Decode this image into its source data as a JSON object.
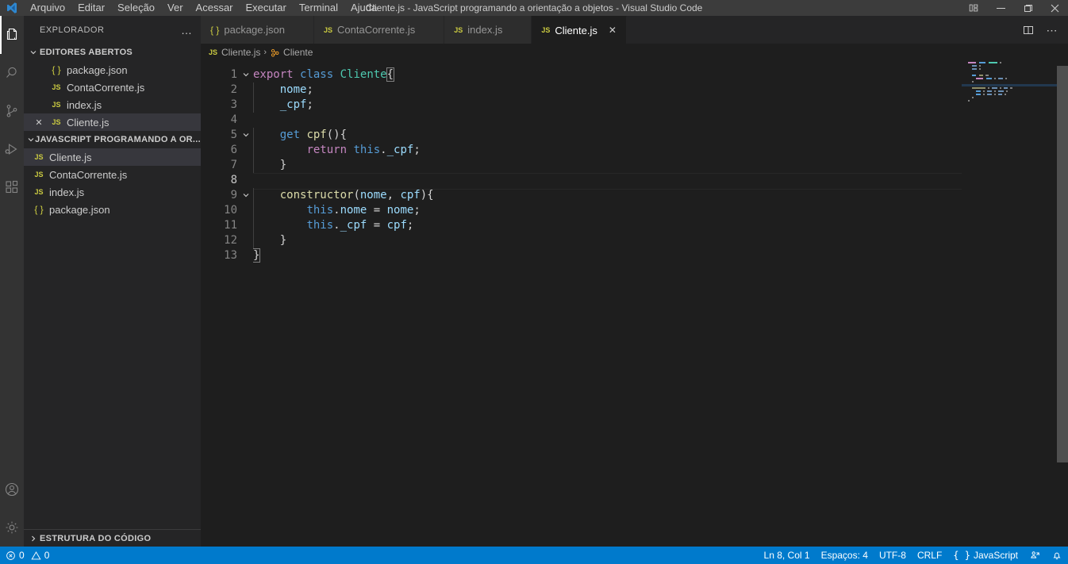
{
  "titlebar": {
    "logo_icon": "vscode-logo-icon",
    "title": "Cliente.js - JavaScript programando a orientação a objetos - Visual Studio Code",
    "menu": [
      {
        "label": "Arquivo"
      },
      {
        "label": "Editar"
      },
      {
        "label": "Seleção"
      },
      {
        "label": "Ver"
      },
      {
        "label": "Acessar"
      },
      {
        "label": "Executar"
      },
      {
        "label": "Terminal"
      },
      {
        "label": "Ajuda"
      }
    ],
    "window_controls": [
      {
        "name": "customize-layout-icon"
      },
      {
        "name": "minimize-icon"
      },
      {
        "name": "maximize-icon"
      },
      {
        "name": "close-icon"
      }
    ]
  },
  "activitybar": {
    "items": [
      {
        "name": "explorer-icon",
        "label": "Explorador",
        "active": true
      },
      {
        "name": "search-icon",
        "label": "Pesquisar",
        "active": false
      },
      {
        "name": "source-control-icon",
        "label": "Controle do Código-Fonte",
        "active": false
      },
      {
        "name": "run-debug-icon",
        "label": "Executar e Depurar",
        "active": false
      },
      {
        "name": "extensions-icon",
        "label": "Extensões",
        "active": false
      }
    ],
    "bottom": [
      {
        "name": "account-icon",
        "label": "Contas"
      },
      {
        "name": "settings-gear-icon",
        "label": "Gerenciar"
      }
    ]
  },
  "sidebar": {
    "title": "EXPLORADOR",
    "more_actions": "…",
    "open_editors": {
      "header": "EDITORES ABERTOS",
      "expanded": true,
      "items": [
        {
          "name": "package.json",
          "icon": "json-file-icon",
          "selected": false,
          "has_close": false
        },
        {
          "name": "ContaCorrente.js",
          "icon": "js-file-icon",
          "selected": false,
          "has_close": false
        },
        {
          "name": "index.js",
          "icon": "js-file-icon",
          "selected": false,
          "has_close": false
        },
        {
          "name": "Cliente.js",
          "icon": "js-file-icon",
          "selected": true,
          "has_close": true
        }
      ]
    },
    "project": {
      "header": "JAVASCRIPT PROGRAMANDO A OR...",
      "expanded": true,
      "items": [
        {
          "name": "Cliente.js",
          "icon": "js-file-icon",
          "selected": true
        },
        {
          "name": "ContaCorrente.js",
          "icon": "js-file-icon",
          "selected": false
        },
        {
          "name": "index.js",
          "icon": "js-file-icon",
          "selected": false
        },
        {
          "name": "package.json",
          "icon": "json-file-icon",
          "selected": false
        }
      ]
    },
    "outline": {
      "header": "ESTRUTURA DO CÓDIGO",
      "expanded": false
    }
  },
  "editor": {
    "tabs": [
      {
        "label": "package.json",
        "icon": "json-file-icon",
        "active": false
      },
      {
        "label": "ContaCorrente.js",
        "icon": "js-file-icon",
        "active": false
      },
      {
        "label": "index.js",
        "icon": "js-file-icon",
        "active": false
      },
      {
        "label": "Cliente.js",
        "icon": "js-file-icon",
        "active": true,
        "close": "✕"
      }
    ],
    "actions": [
      {
        "name": "split-editor-icon"
      },
      {
        "name": "more-actions-icon",
        "label": "⋯"
      }
    ],
    "breadcrumb": {
      "file": "Cliente.js",
      "separator": "›",
      "symbol": "Cliente"
    },
    "line_count": 13,
    "current_line": 8,
    "lines": [
      {
        "n": 1,
        "fold": "v",
        "tokens": [
          {
            "t": "export",
            "c": "kw-export"
          },
          {
            "t": " ",
            "c": "punc"
          },
          {
            "t": "class",
            "c": "kw-class"
          },
          {
            "t": " ",
            "c": "punc"
          },
          {
            "t": "Cliente",
            "c": "type"
          },
          {
            "t": "{",
            "c": "punc cursor-box"
          }
        ]
      },
      {
        "n": 2,
        "fold": "",
        "tokens": [
          {
            "t": "    ",
            "c": "punc"
          },
          {
            "t": "nome",
            "c": "prop"
          },
          {
            "t": ";",
            "c": "punc"
          }
        ]
      },
      {
        "n": 3,
        "fold": "",
        "tokens": [
          {
            "t": "    ",
            "c": "punc"
          },
          {
            "t": "_cpf",
            "c": "prop"
          },
          {
            "t": ";",
            "c": "punc"
          }
        ]
      },
      {
        "n": 4,
        "fold": "",
        "tokens": []
      },
      {
        "n": 5,
        "fold": "v",
        "tokens": [
          {
            "t": "    ",
            "c": "punc"
          },
          {
            "t": "get",
            "c": "kw-get"
          },
          {
            "t": " ",
            "c": "punc"
          },
          {
            "t": "cpf",
            "c": "fn"
          },
          {
            "t": "(){",
            "c": "punc"
          }
        ]
      },
      {
        "n": 6,
        "fold": "",
        "tokens": [
          {
            "t": "        ",
            "c": "punc"
          },
          {
            "t": "return",
            "c": "kw-return"
          },
          {
            "t": " ",
            "c": "punc"
          },
          {
            "t": "this",
            "c": "kw-this"
          },
          {
            "t": ".",
            "c": "punc"
          },
          {
            "t": "_cpf",
            "c": "prop"
          },
          {
            "t": ";",
            "c": "punc"
          }
        ]
      },
      {
        "n": 7,
        "fold": "",
        "tokens": [
          {
            "t": "    ",
            "c": "punc"
          },
          {
            "t": "}",
            "c": "punc"
          }
        ]
      },
      {
        "n": 8,
        "fold": "",
        "tokens": []
      },
      {
        "n": 9,
        "fold": "v",
        "tokens": [
          {
            "t": "    ",
            "c": "punc"
          },
          {
            "t": "constructor",
            "c": "fn"
          },
          {
            "t": "(",
            "c": "punc"
          },
          {
            "t": "nome",
            "c": "param"
          },
          {
            "t": ", ",
            "c": "punc"
          },
          {
            "t": "cpf",
            "c": "param"
          },
          {
            "t": "){",
            "c": "punc"
          }
        ]
      },
      {
        "n": 10,
        "fold": "",
        "tokens": [
          {
            "t": "        ",
            "c": "punc"
          },
          {
            "t": "this",
            "c": "kw-this"
          },
          {
            "t": ".",
            "c": "punc"
          },
          {
            "t": "nome",
            "c": "prop"
          },
          {
            "t": " = ",
            "c": "op"
          },
          {
            "t": "nome",
            "c": "prop"
          },
          {
            "t": ";",
            "c": "punc"
          }
        ]
      },
      {
        "n": 11,
        "fold": "",
        "tokens": [
          {
            "t": "        ",
            "c": "punc"
          },
          {
            "t": "this",
            "c": "kw-this"
          },
          {
            "t": ".",
            "c": "punc"
          },
          {
            "t": "_cpf",
            "c": "prop"
          },
          {
            "t": " = ",
            "c": "op"
          },
          {
            "t": "cpf",
            "c": "prop"
          },
          {
            "t": ";",
            "c": "punc"
          }
        ]
      },
      {
        "n": 12,
        "fold": "",
        "tokens": [
          {
            "t": "    ",
            "c": "punc"
          },
          {
            "t": "}",
            "c": "punc"
          }
        ]
      },
      {
        "n": 13,
        "fold": "",
        "tokens": [
          {
            "t": "}",
            "c": "punc cursor-box"
          }
        ]
      }
    ]
  },
  "statusbar": {
    "left": [
      {
        "name": "problems-errors",
        "icon": "error-circle-icon",
        "label": "0"
      },
      {
        "name": "problems-warnings",
        "icon": "warning-triangle-icon",
        "label": "0"
      }
    ],
    "right": [
      {
        "name": "cursor-position",
        "label": "Ln 8, Col 1"
      },
      {
        "name": "indentation",
        "label": "Espaços: 4"
      },
      {
        "name": "encoding",
        "label": "UTF-8"
      },
      {
        "name": "eol",
        "label": "CRLF"
      },
      {
        "name": "language-mode",
        "label": "JavaScript",
        "icon": "json-brace-icon"
      },
      {
        "name": "live-share-icon",
        "label": ""
      },
      {
        "name": "notifications-bell-icon",
        "label": ""
      }
    ]
  },
  "colors": {
    "accent": "#007acc",
    "titlebar_bg": "#3c3c3c",
    "sidebar_bg": "#252526",
    "editor_bg": "#1e1e1e",
    "activitybar_bg": "#333333",
    "selection": "#37373d",
    "js_icon": "#cbcb41",
    "class_icon": "#ee9d28"
  }
}
